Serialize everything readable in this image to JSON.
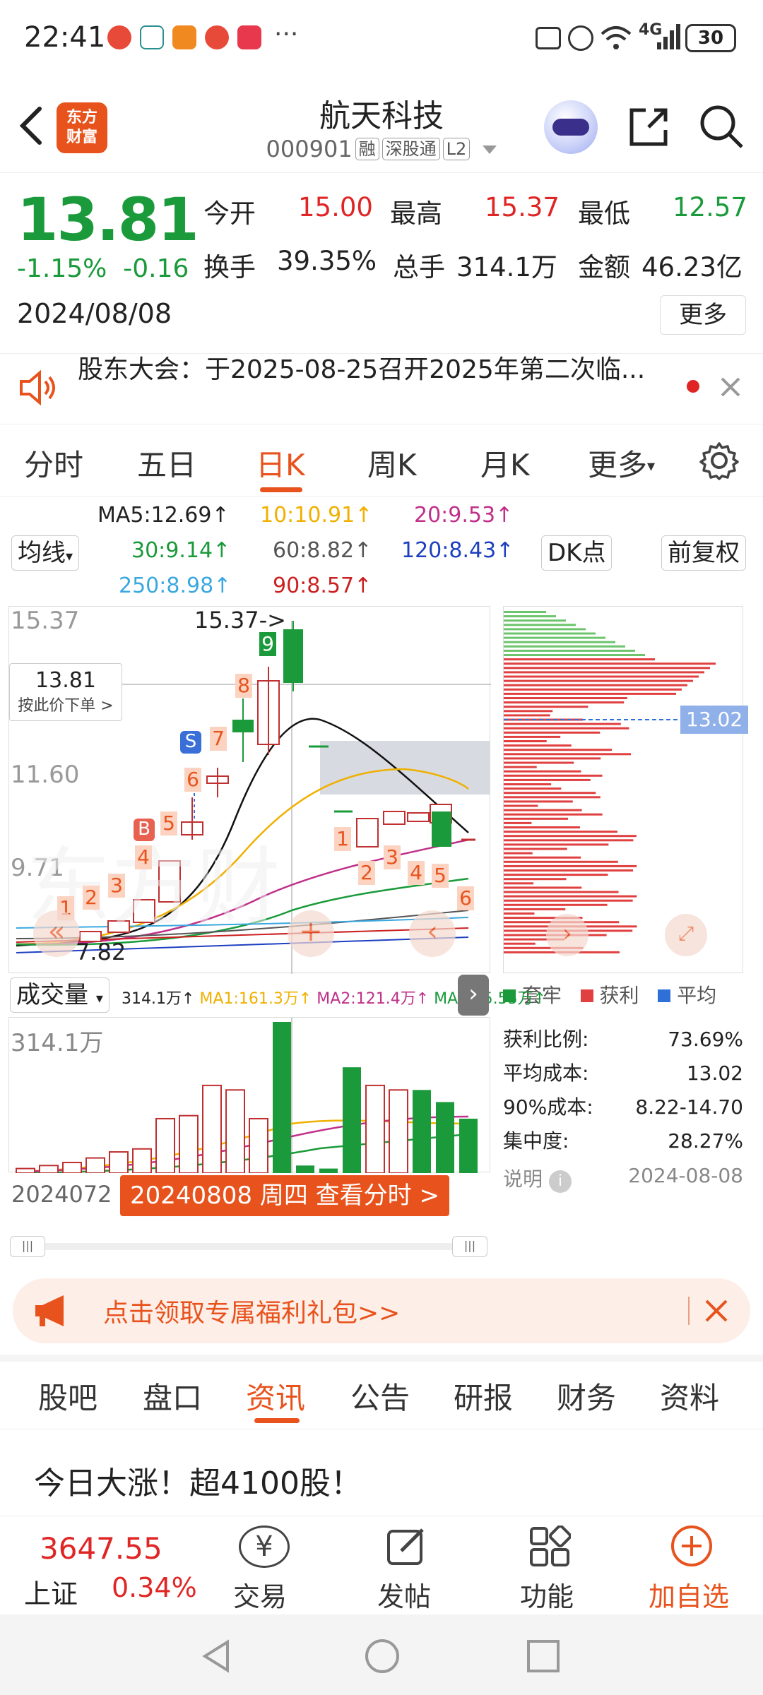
{
  "status": {
    "time": "22:41",
    "battery": "30",
    "more": "···",
    "network": "4G"
  },
  "header": {
    "logo_line1": "东方",
    "logo_line2": "财富",
    "title": "航天科技",
    "code": "000901",
    "tags": [
      "融",
      "深股通",
      "L2"
    ]
  },
  "quote": {
    "price": "13.81",
    "change_pct": "-1.15%",
    "change": "-0.16",
    "date": "2024/08/08",
    "open_label": "今开",
    "open": "15.00",
    "high_label": "最高",
    "high": "15.37",
    "low_label": "最低",
    "low": "12.57",
    "turnover_label": "换手",
    "turnover": "39.35%",
    "volume_label": "总手",
    "volume": "314.1万",
    "amount_label": "金额",
    "amount": "46.23亿",
    "more_label": "更多"
  },
  "notice": {
    "text": "股东大会：于2025-08-25召开2025年第二次临..."
  },
  "tabs": [
    "分时",
    "五日",
    "日K",
    "周K",
    "月K",
    "更多"
  ],
  "active_tab": "日K",
  "ma_lines": {
    "ma5": "MA5:12.69↑",
    "ma10": "10:10.91↑",
    "ma20": "20:9.53↑",
    "ma30": "30:9.14↑",
    "ma60": "60:8.82↑",
    "ma120": "120:8.43↑",
    "ma250": "250:8.98↑",
    "ma90": "90:8.57↑",
    "selector": "均线",
    "dk": "DK点",
    "fq": "前复权",
    "colors": {
      "ma5": "#222222",
      "ma10": "#f0b000",
      "ma20": "#c0308a",
      "ma30": "#1a9a3a",
      "ma60": "#555555",
      "ma120": "#1e40c0",
      "ma250": "#3aa8e0",
      "ma90": "#cc2020"
    }
  },
  "kchart": {
    "y_top": "15.37",
    "y_mid": "11.60",
    "y_low": "9.71",
    "y_min": "7.82",
    "high_marker": "15.37->",
    "crosshair_price": "13.81",
    "crosshair_hint": "按此价下单 >",
    "signals": [
      "1",
      "2",
      "3",
      "4",
      "5",
      "6",
      "7",
      "8",
      "9"
    ],
    "signals2": [
      "1",
      "2",
      "3",
      "4",
      "5",
      "6"
    ],
    "buy_label": "B",
    "sell_label": "S",
    "watermark": "东方财"
  },
  "chip": {
    "avg_tag": "13.02",
    "legend": [
      "套牢",
      "获利",
      "平均"
    ],
    "legend_colors": [
      "#1a9a3a",
      "#e04040",
      "#2f6fd8"
    ],
    "rows": [
      {
        "label": "获利比例:",
        "value": "73.69%"
      },
      {
        "label": "平均成本:",
        "value": "13.02"
      },
      {
        "label": "90%成本:",
        "value": "8.22-14.70"
      },
      {
        "label": "集中度:",
        "value": "28.27%"
      }
    ],
    "note": "说明",
    "note_date": "2024-08-08"
  },
  "volume": {
    "selector": "成交量",
    "summary": "314.1万↑",
    "ma1": "MA1:161.3万↑",
    "ma2": "MA2:121.4万↑",
    "ma3": "MA3:65.55万↑",
    "y_top": "314.1万",
    "date_left": "2024072",
    "tooltip": "20240808 周四 查看分时 >",
    "bars": [
      {
        "v": 0.03,
        "up": true
      },
      {
        "v": 0.05,
        "up": true
      },
      {
        "v": 0.07,
        "up": true
      },
      {
        "v": 0.1,
        "up": true
      },
      {
        "v": 0.14,
        "up": true
      },
      {
        "v": 0.16,
        "up": true
      },
      {
        "v": 0.36,
        "up": true
      },
      {
        "v": 0.38,
        "up": true
      },
      {
        "v": 0.58,
        "up": true
      },
      {
        "v": 0.55,
        "up": true
      },
      {
        "v": 0.36,
        "up": true
      },
      {
        "v": 1.0,
        "up": false
      },
      {
        "v": 0.05,
        "up": false
      },
      {
        "v": 0.03,
        "up": false
      },
      {
        "v": 0.7,
        "up": false
      },
      {
        "v": 0.58,
        "up": true
      },
      {
        "v": 0.55,
        "up": true
      },
      {
        "v": 0.55,
        "up": false
      },
      {
        "v": 0.47,
        "up": false
      },
      {
        "v": 0.36,
        "up": false
      }
    ]
  },
  "promo": {
    "text": "点击领取专属福利礼包>>"
  },
  "subtabs": [
    "股吧",
    "盘口",
    "资讯",
    "公告",
    "研报",
    "财务",
    "资料"
  ],
  "active_subtab": "资讯",
  "news": {
    "headline": "今日大涨！超4100股！"
  },
  "bottom": {
    "index_value": "3647.55",
    "index_name": "上证",
    "index_change": "0.34%",
    "actions": [
      "交易",
      "发帖",
      "功能",
      "加自选"
    ]
  }
}
